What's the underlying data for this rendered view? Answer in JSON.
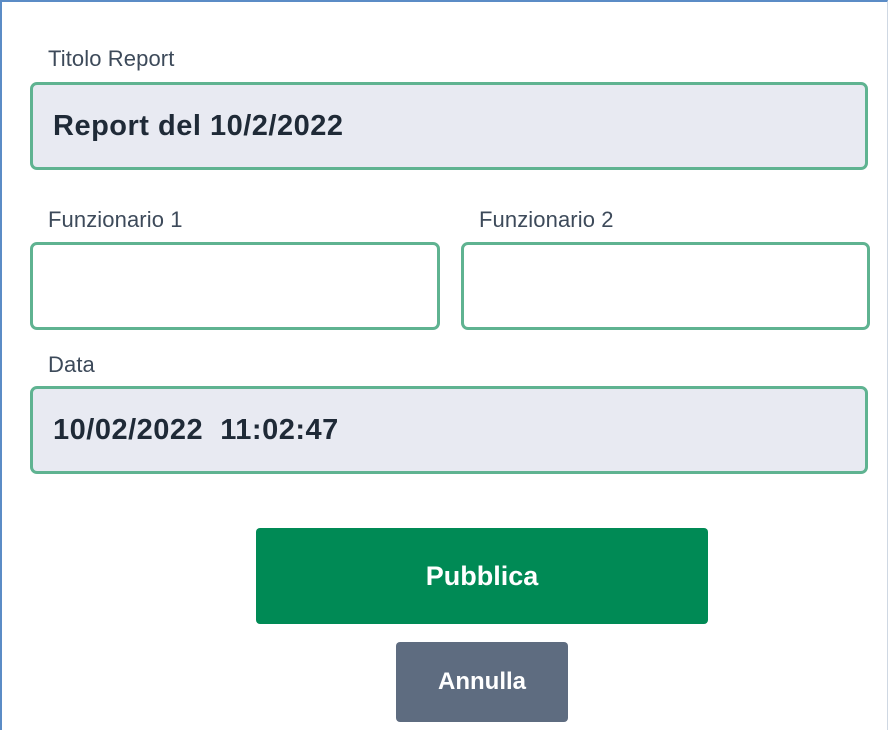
{
  "form": {
    "title_label": "Titolo Report",
    "title_value": "Report del 10/2/2022",
    "funz1_label": "Funzionario 1",
    "funz1_value": "",
    "funz2_label": "Funzionario 2",
    "funz2_value": "",
    "date_label": "Data",
    "date_value": "10/02/2022  11:02:47"
  },
  "actions": {
    "publish_label": "Pubblica",
    "cancel_label": "Annulla"
  },
  "colors": {
    "field_border": "#5fb391",
    "readonly_bg": "#e8eaf2",
    "primary": "#008a55",
    "secondary": "#5e6c80"
  }
}
